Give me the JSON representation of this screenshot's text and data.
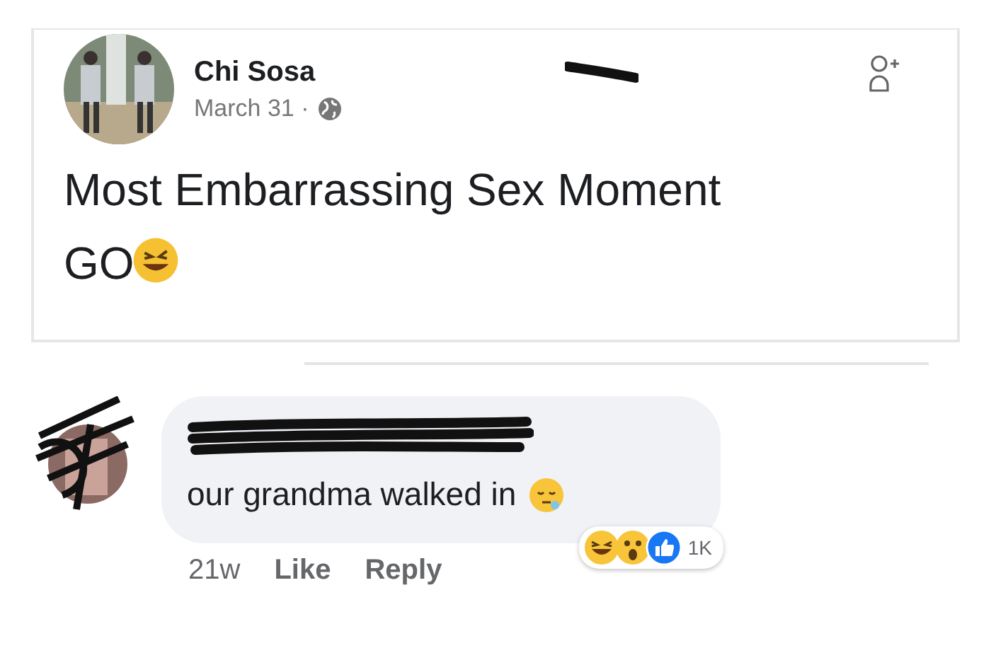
{
  "post": {
    "author": "Chi Sosa",
    "date": "March 31 ·",
    "text": "Most Embarrassing Sex Moment GO"
  },
  "comment": {
    "text": "our grandma walked in",
    "time": "21w",
    "actions": [
      "Like",
      "Reply"
    ],
    "reaction_count": "1K"
  }
}
